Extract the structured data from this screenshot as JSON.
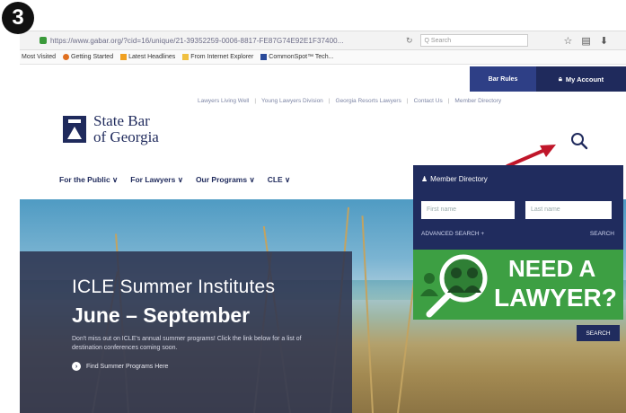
{
  "step": "3",
  "browser": {
    "url": "https://www.gabar.org/?cid=16/unique/21-39352259-0006-8817-FE87G74E92E1F37400...",
    "search_placeholder": "Q Search",
    "bookmarks": [
      "Most Visited",
      "Getting Started",
      "Latest Headlines",
      "From Internet Explorer",
      "CommonSpot™ Tech..."
    ]
  },
  "site": {
    "top_buttons": {
      "bar_rules": "Bar Rules",
      "my_account": "My Account"
    },
    "util_nav": [
      "Lawyers Living Well",
      "Young Lawyers Division",
      "Georgia Resorts Lawyers",
      "Contact Us",
      "Member Directory"
    ],
    "logo": {
      "line1": "State Bar",
      "line2": "of Georgia"
    },
    "main_nav": [
      "For the Public ∨",
      "For Lawyers ∨",
      "Our Programs ∨",
      "CLE ∨"
    ],
    "promo": {
      "title": "ICLE Summer Institutes",
      "dates": "June – September",
      "body": "Don't miss out on ICLE's annual summer programs! Click the link below for a list of destination conferences coming soon.",
      "link": "Find Summer Programs Here"
    },
    "member_directory": {
      "title": "Member Directory",
      "first_name_placeholder": "First name",
      "last_name_placeholder": "Last name",
      "advanced_search": "ADVANCED SEARCH +",
      "search": "SEARCH"
    },
    "need_lawyer": {
      "line1": "NEED A",
      "line2": "LAWYER?",
      "search": "SEARCH"
    }
  },
  "colors": {
    "navy": "#1f2a5c",
    "accent_blue": "#2e3f86",
    "green": "#3d9f43",
    "arrow_red": "#c0162a"
  }
}
